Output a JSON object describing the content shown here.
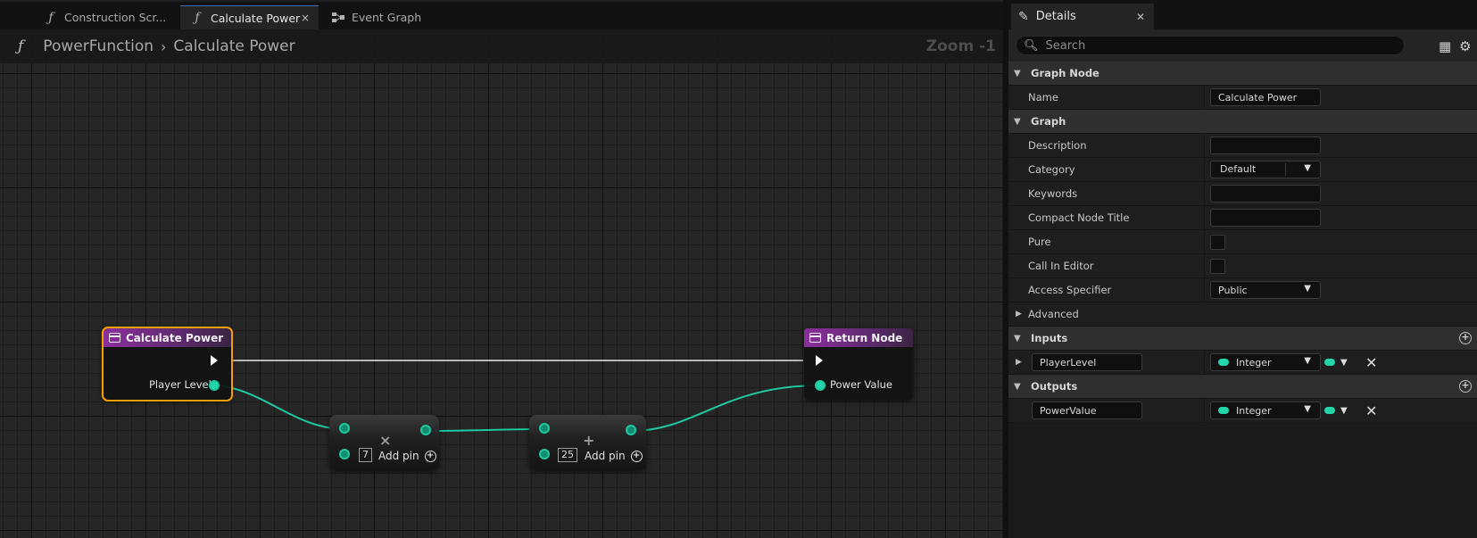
{
  "tabs": [
    {
      "label": "Construction Scr...",
      "icon": "function-icon",
      "active": false
    },
    {
      "label": "Calculate Power",
      "icon": "function-icon",
      "active": true,
      "close": "×"
    },
    {
      "label": "Event Graph",
      "icon": "event-graph-icon",
      "active": false
    }
  ],
  "breadcrumb": {
    "icon": "ƒ",
    "parent": "PowerFunction",
    "separator": "›",
    "current": "Calculate Power"
  },
  "zoom": "Zoom -1",
  "nodes": {
    "entry": {
      "title": "Calculate Power",
      "pin": "Player Level"
    },
    "return": {
      "title": "Return Node",
      "pin": "Power Value"
    },
    "multiply": {
      "operator": "×",
      "value": "7",
      "add_pin": "Add pin"
    },
    "add": {
      "operator": "+",
      "value": "25",
      "add_pin": "Add pin"
    }
  },
  "details": {
    "tab_label": "Details",
    "search_placeholder": "Search",
    "categories": {
      "graph_node": "Graph Node",
      "graph": "Graph",
      "advanced": "Advanced",
      "inputs": "Inputs",
      "outputs": "Outputs"
    },
    "props": {
      "name_label": "Name",
      "name_value": "Calculate Power",
      "description_label": "Description",
      "description_value": "",
      "category_label": "Category",
      "category_value": "Default",
      "keywords_label": "Keywords",
      "keywords_value": "",
      "compact_label": "Compact Node Title",
      "compact_value": "",
      "pure_label": "Pure",
      "pure_checked": false,
      "call_in_editor_label": "Call In Editor",
      "call_in_editor_checked": false,
      "access_label": "Access Specifier",
      "access_value": "Public"
    },
    "inputs": [
      {
        "name": "PlayerLevel",
        "type": "Integer"
      }
    ],
    "outputs": [
      {
        "name": "PowerValue",
        "type": "Integer"
      }
    ]
  },
  "colors": {
    "accent": "#f5a000",
    "pin_integer": "#22d6aa",
    "node_header": "#8a2f9c"
  }
}
